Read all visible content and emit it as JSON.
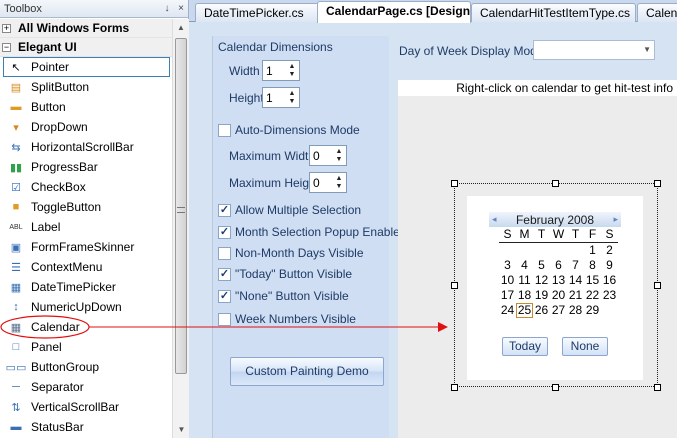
{
  "toolbox": {
    "title": "Toolbox",
    "pin_glyph": "↓",
    "close_glyph": "×",
    "sections": [
      {
        "label": "All Windows Forms",
        "expanded_glyph": "+"
      },
      {
        "label": "Elegant UI",
        "expanded_glyph": "−"
      }
    ],
    "items": [
      {
        "label": "Pointer",
        "icon": "pointer-icon",
        "glyph": "↖",
        "color": "#000000"
      },
      {
        "label": "SplitButton",
        "icon": "split-button-icon",
        "glyph": "▤",
        "color": "#d68a1a"
      },
      {
        "label": "Button",
        "icon": "button-icon",
        "glyph": "▬",
        "color": "#e19a25"
      },
      {
        "label": "DropDown",
        "icon": "dropdown-icon",
        "glyph": "▾",
        "color": "#d68a1a"
      },
      {
        "label": "HorizontalScrollBar",
        "icon": "hscrollbar-icon",
        "glyph": "⇆",
        "color": "#3a6fb6"
      },
      {
        "label": "ProgressBar",
        "icon": "progressbar-icon",
        "glyph": "▮▮",
        "color": "#2fa24a"
      },
      {
        "label": "CheckBox",
        "icon": "checkbox-icon",
        "glyph": "☑",
        "color": "#2c6bc2"
      },
      {
        "label": "ToggleButton",
        "icon": "toggle-button-icon",
        "glyph": "■",
        "color": "#e19a25"
      },
      {
        "label": "Label",
        "icon": "label-icon",
        "glyph": "ABL",
        "color": "#333333"
      },
      {
        "label": "FormFrameSkinner",
        "icon": "form-skinner-icon",
        "glyph": "▣",
        "color": "#3a6fb6"
      },
      {
        "label": "ContextMenu",
        "icon": "context-menu-icon",
        "glyph": "☰",
        "color": "#3a6fb6"
      },
      {
        "label": "DateTimePicker",
        "icon": "datetimepicker-icon",
        "glyph": "▦",
        "color": "#3a6fb6"
      },
      {
        "label": "NumericUpDown",
        "icon": "numeric-updown-icon",
        "glyph": "↕",
        "color": "#3a6fb6"
      },
      {
        "label": "Calendar",
        "icon": "calendar-icon",
        "glyph": "▦",
        "color": "#5a6f8f"
      },
      {
        "label": "Panel",
        "icon": "panel-icon",
        "glyph": "□",
        "color": "#3a6fb6"
      },
      {
        "label": "ButtonGroup",
        "icon": "button-group-icon",
        "glyph": "▭▭",
        "color": "#3a6fb6"
      },
      {
        "label": "Separator",
        "icon": "separator-icon",
        "glyph": "─",
        "color": "#3a6fb6"
      },
      {
        "label": "VerticalScrollBar",
        "icon": "vscrollbar-icon",
        "glyph": "⇅",
        "color": "#3a6fb6"
      },
      {
        "label": "StatusBar",
        "icon": "statusbar-icon",
        "glyph": "▬",
        "color": "#3a6fb6"
      }
    ],
    "scroll_up": "▲",
    "scroll_down": "▼"
  },
  "tabs": [
    {
      "label": "DateTimePicker.cs",
      "active": false
    },
    {
      "label": "CalendarPage.cs [Design]*",
      "active": true
    },
    {
      "label": "CalendarHitTestItemType.cs",
      "active": false
    },
    {
      "label": "Calendar",
      "active": false
    }
  ],
  "options": {
    "calendar_dimensions_label": "Calendar Dimensions",
    "width_label": "Width",
    "width_value": "1",
    "height_label": "Height",
    "height_value": "1",
    "auto_dimensions_label": "Auto-Dimensions Mode",
    "auto_dimensions_checked": false,
    "max_width_label": "Maximum Width",
    "max_width_value": "0",
    "max_height_label": "Maximum Height",
    "max_height_value": "0",
    "checkboxes": [
      {
        "label": "Allow Multiple Selection",
        "checked": true
      },
      {
        "label": "Month Selection Popup Enabled",
        "checked": true
      },
      {
        "label": "Non-Month Days Visible",
        "checked": false
      },
      {
        "label": "\"Today\" Button Visible",
        "checked": true
      },
      {
        "label": "\"None\" Button Visible",
        "checked": true
      },
      {
        "label": "Week Numbers Visible",
        "checked": false
      }
    ],
    "custom_painting_button": "Custom Painting Demo",
    "day_of_week_label": "Day of Week Display Mode",
    "day_of_week_value": ""
  },
  "hit_test_hint": "Right-click on calendar to get hit-test info",
  "calendar": {
    "month_label": "February 2008",
    "prev_glyph": "◂",
    "next_glyph": "▸",
    "day_headers": [
      "S",
      "M",
      "T",
      "W",
      "T",
      "F",
      "S"
    ],
    "weeks": [
      [
        "",
        "",
        "",
        "",
        "",
        "1",
        "2"
      ],
      [
        "3",
        "4",
        "5",
        "6",
        "7",
        "8",
        "9"
      ],
      [
        "10",
        "11",
        "12",
        "13",
        "14",
        "15",
        "16"
      ],
      [
        "17",
        "18",
        "19",
        "20",
        "21",
        "22",
        "23"
      ],
      [
        "24",
        "25",
        "26",
        "27",
        "28",
        "29",
        ""
      ]
    ],
    "today_day": "25",
    "today_button": "Today",
    "none_button": "None"
  },
  "colors": {
    "annotation_red": "#e01010",
    "selection_border": "#3c7fb1"
  }
}
